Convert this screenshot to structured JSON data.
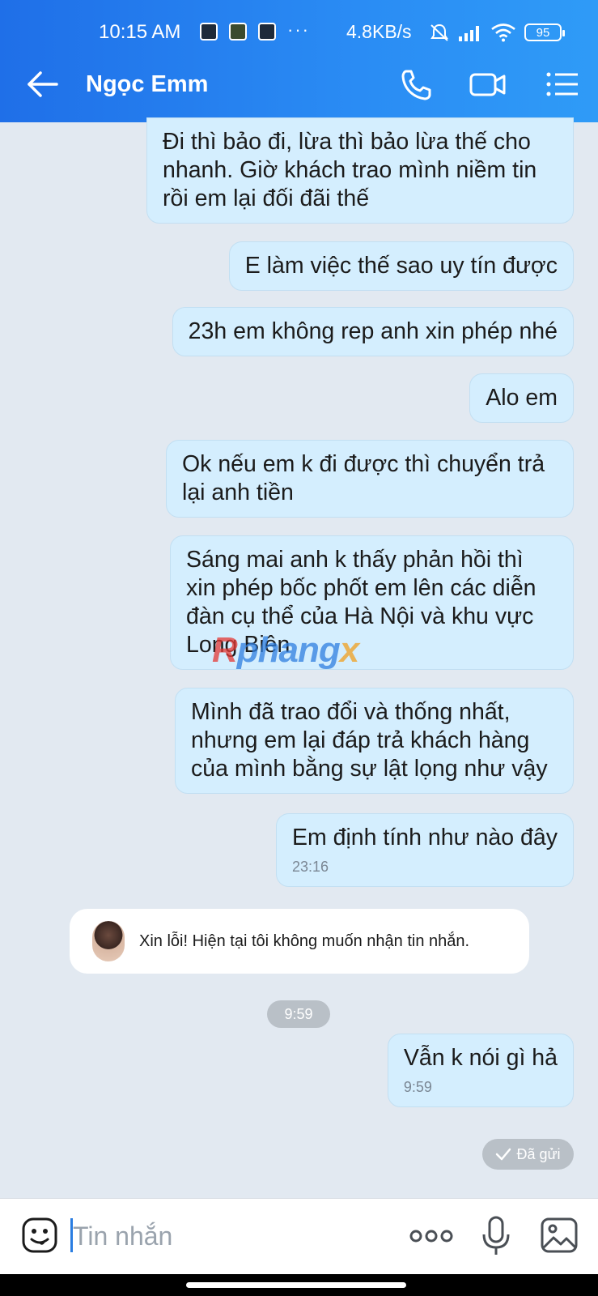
{
  "status_bar": {
    "time": "10:15 AM",
    "dots": "···",
    "network_speed": "4.8KB/s",
    "battery": "95"
  },
  "header": {
    "title": "Ngọc Emm",
    "icons": [
      "back-arrow-icon",
      "phone-icon",
      "video-call-icon",
      "menu-icon"
    ]
  },
  "messages": [
    {
      "text": "Đi thì bảo đi, lừa thì bảo lừa thế cho nhanh. Giờ khách trao mình niềm tin rồi em lại đối đãi thế"
    },
    {
      "text": "E làm việc thế sao uy tín được"
    },
    {
      "text": "23h em không rep anh xin phép nhé"
    },
    {
      "text": "Alo em"
    },
    {
      "text": "Ok nếu em k đi được thì chuyển trả lại anh tiền"
    },
    {
      "text": "Sáng mai anh k thấy phản hồi thì xin phép bốc phốt em lên các diễn đàn cụ thể của Hà Nội và khu vực Long Biên"
    },
    {
      "text": "Mình đã trao đổi và thống nhất, nhưng em lại đáp trả khách hàng của mình bằng sự lật lọng như vậy"
    },
    {
      "text": "Em định tính như nào đây",
      "time": "23:16"
    }
  ],
  "auto_reply": {
    "text": "Xin lỗi! Hiện tại tôi không muốn nhận tin nhắn."
  },
  "date_divider": "9:59",
  "last_message": {
    "text": "Vẫn k nói gì hả",
    "time": "9:59"
  },
  "sent_status": "Đã gửi",
  "watermark": {
    "part1": "R",
    "part2": "phang",
    "part3": "x"
  },
  "composer": {
    "placeholder": "Tin nhắn",
    "icons": [
      "emoji-icon",
      "more-icon",
      "microphone-icon",
      "image-icon"
    ]
  },
  "colors": {
    "header_start": "#1f6fe8",
    "header_end": "#2f9bf7",
    "bubble": "#d4eefe",
    "background": "#e2e9f1"
  }
}
